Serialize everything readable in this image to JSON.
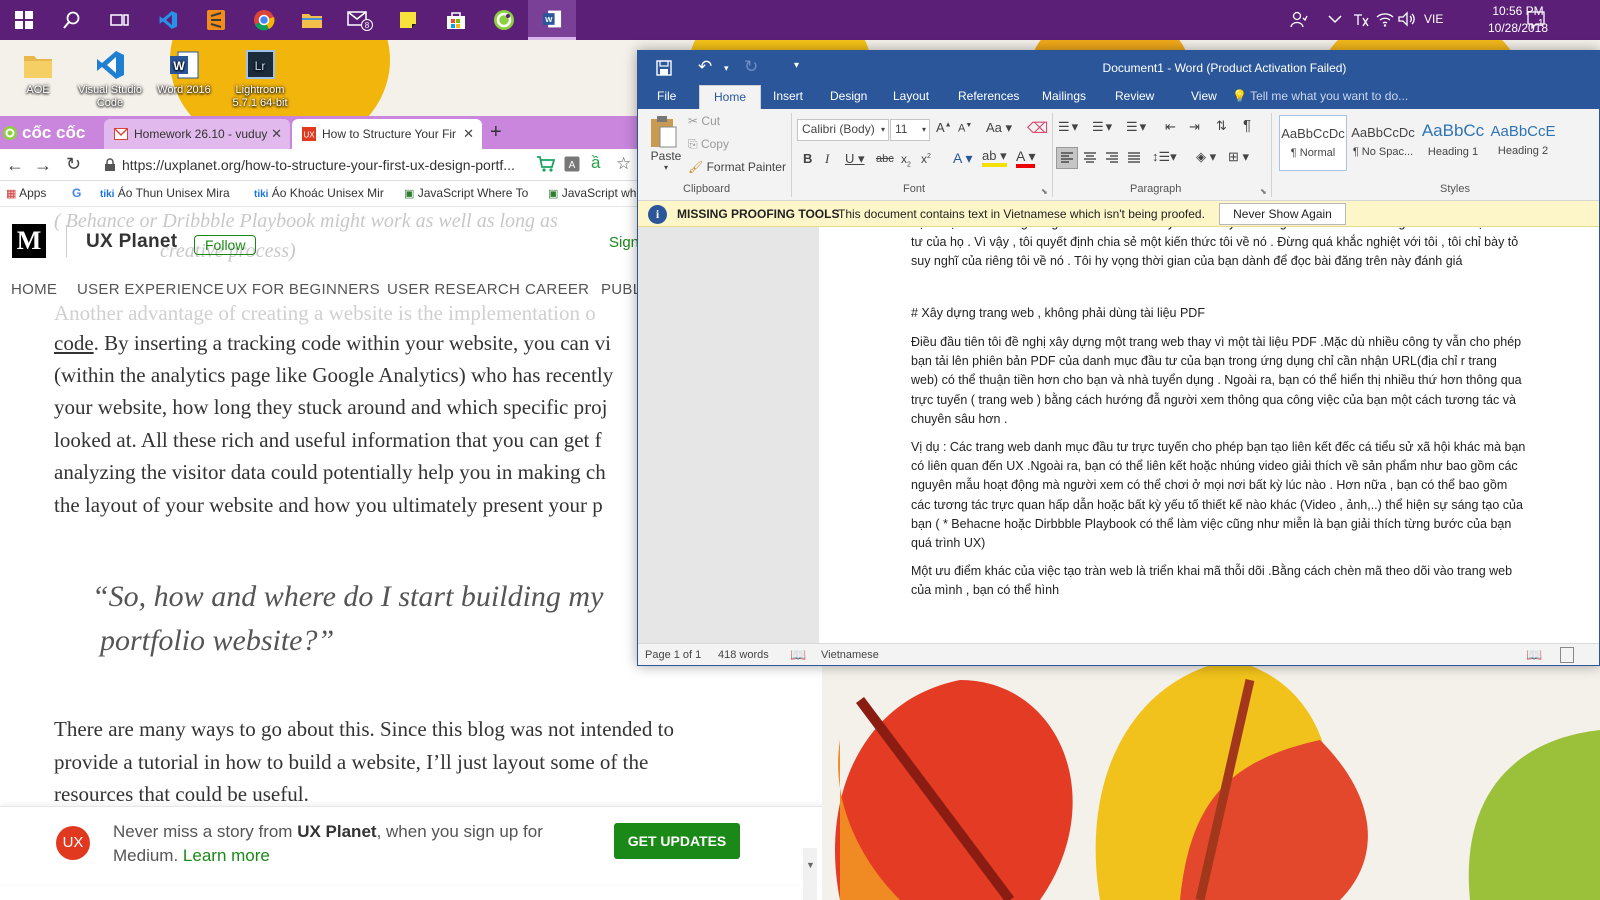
{
  "taskbar": {
    "apps": [
      "start-icon",
      "search-icon",
      "task-view-icon",
      "visual-studio-code-icon",
      "sublime-text-icon",
      "chrome-icon",
      "file-explorer-icon",
      "mail-icon",
      "sticky-notes-icon",
      "store-icon",
      "coc-coc-icon",
      "word-icon"
    ],
    "mail_badge": "8",
    "language": "VIE",
    "time": "10:56 PM",
    "date": "10/28/2018",
    "notification_count": "1"
  },
  "desktop": {
    "icons": [
      {
        "label": "AOE"
      },
      {
        "label": "Visual Studio Code"
      },
      {
        "label": "Word 2016"
      },
      {
        "label": "Lightroom 5.7.1 64-bit"
      }
    ]
  },
  "browser": {
    "brand": "cốc cốc",
    "tabs": [
      {
        "title": "Homework 26.10 - vuduy"
      },
      {
        "title": "How to Structure Your Fir"
      }
    ],
    "url": "https://uxplanet.org/how-to-structure-your-first-ux-design-portf...",
    "bookmarks": [
      "Apps",
      "Áo Thun Unisex Mira",
      "Áo Khoác Unisex Mir",
      "JavaScript Where To",
      "JavaScript wh"
    ],
    "site_name": "UX Planet",
    "follow_label": "Follow",
    "signin_label": "Sign",
    "nav": [
      "HOME",
      "USER EXPERIENCE",
      "UX FOR BEGINNERS",
      "USER RESEARCH",
      "CAREER",
      "PUBL"
    ],
    "faded_lines": [
      "( Behance or Dribbble Playbook might work as well as long as",
      "creative process)"
    ],
    "para1": [
      "Another advantage of creating a website is the implementation o",
      ". By inserting a tracking code within your website, you can vi",
      "(within the analytics page like Google Analytics) who has recently",
      "your website, how long they stuck around and which specific proj",
      "looked at. All these rich and useful information that you can get f",
      "analyzing the visitor data could potentially help you in making ch",
      "the layout of your website and how you ultimately present your p"
    ],
    "para1_link": "code",
    "quote": [
      "“So, how and where do I start building my",
      "portfolio website?”"
    ],
    "para2": [
      "There are many ways to go about this. Since this blog was not intended to",
      "provide a tutorial in how to build a website, I’ll just layout some of the",
      "resources that could be useful."
    ],
    "signup": {
      "badge": "UX",
      "text_pre": "Never miss a story from ",
      "publication": "UX Planet",
      "text_post": ", when you sign up for",
      "text_line2": "Medium. ",
      "learn_more": "Learn more",
      "button": "GET UPDATES"
    }
  },
  "word": {
    "title": "Document1 - Word (Product Activation Failed)",
    "tabs": [
      "File",
      "Home",
      "Insert",
      "Design",
      "Layout",
      "References",
      "Mailings",
      "Review",
      "View"
    ],
    "tell_me": "Tell me what you want to do...",
    "clipboard": {
      "paste": "Paste",
      "cut": "Cut",
      "copy": "Copy",
      "format_painter": "Format Painter",
      "label": "Clipboard"
    },
    "font": {
      "name": "Calibri (Body)",
      "size": "11",
      "label": "Font"
    },
    "paragraph_label": "Paragraph",
    "styles": {
      "label": "Styles",
      "items": [
        {
          "preview": "AaBbCcDc",
          "name": "¶ Normal"
        },
        {
          "preview": "AaBbCcDc",
          "name": "¶ No Spac..."
        },
        {
          "preview": "AaBbCc",
          "name": "Heading 1"
        },
        {
          "preview": "AaBbCcE",
          "name": "Heading 2"
        }
      ]
    },
    "message": {
      "title": "MISSING PROOFING TOOLS",
      "text": "This document contains text in Vietnamese which isn't being proofed.",
      "button": "Never Show Again"
    },
    "doc": {
      "p0": "bạn. Mặn dù tôi cũng là người mới cho đến nay nhiều đã yêu chúng tôi xem xét các trang web  danh mục đầu tư của họ . Vì vậy , tôi quyết định chia sẻ một kiến thức  tôi về nó . Đừng quá khắc nghiệt với tôi , tôi chỉ bày tỏ suy nghĩ của riêng tôi về nó . Tôi hy vọng thời gian của bạn dành để đọc bài đăng trên này đánh giá",
      "p1": "# Xây dựng trang web , không phải dùng tài liệu PDF",
      "p2": "Điều đầu tiên tôi đề nghị xây dựng một trang web thay vì một tài liệu PDF .Mặc dù nhiều công ty  vẫn cho phép bạn tải lên phiên bản PDF của danh mục đầu tư của bạn trong ứng dụng chỉ cần nhận URL(địa chỉ r trang web) có thể thuận tiền hơn cho bạn và nhà tuyển dụng . Ngoài ra, bạn có thể hiển thị nhiều thứ hơn thông qua trực tuyến ( trang web ) bằng cách hướng đẫ người xem thông qua công việc của bạn một cách tương tác và chuyên sâu hơn .",
      "p3": "Vị dụ : Các trang web danh mục đầu tư trực tuyến cho phép bạn tạo liên kết đếc cá tiểu sử xã hội khác mà bạn có liên quan đến UX .Ngoài ra, bạn có thể liên kết hoặc nhúng video giải thích về sản phẩm như bao gồm các nguyên mẫu hoạt động mà người xem có thể chơi ở mọi nơi bất kỳ lúc nào . Hơn nữa , bạn có thể bao gồm các tương tác trực quan hấp dẫn hoặc bất kỳ yếu tố thiết kế nào khác (Video , ảnh,..) thể hiện sự sáng tạo của bạn ( * Behacne hoặc Dirbbble Playbook có thể làm việc cũng như miễn là bạn giải thích từng bước của bạn quá trình UX)",
      "p4": "Một ưu điểm khác của việc tạo tràn web là triển khai mã thỗi dõi .Bằng cách chèn mã theo dõi vào trang web của mình , bạn có thể hình"
    },
    "status": {
      "page": "Page 1 of 1",
      "words": "418 words",
      "language": "Vietnamese"
    }
  },
  "colors": {
    "taskbar": "#5c1f78",
    "word_blue": "#2b579a",
    "browser_tabs": "#c986dc",
    "medium_green": "#1a8917"
  }
}
